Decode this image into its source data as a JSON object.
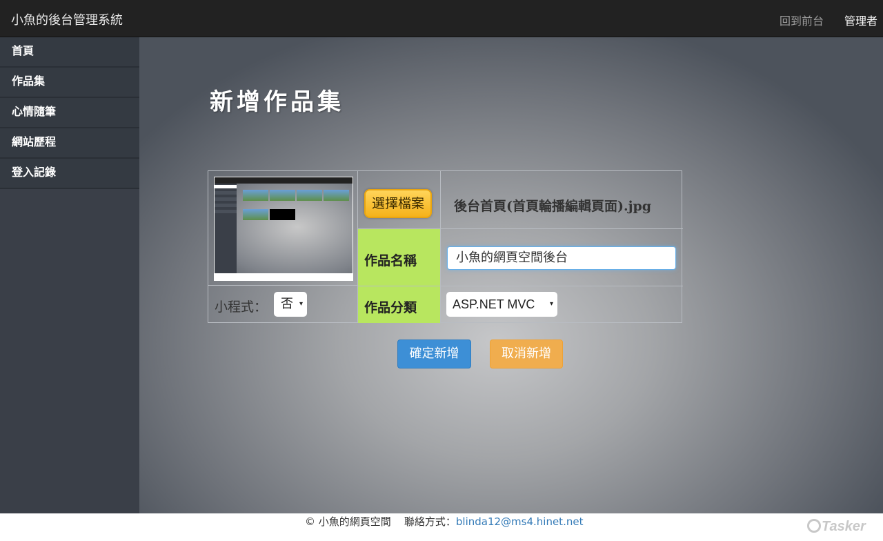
{
  "header": {
    "brand": "小魚的後台管理系統",
    "nav_front": "回到前台",
    "nav_admin": "管理者"
  },
  "sidebar": {
    "items": [
      {
        "label": "首頁"
      },
      {
        "label": "作品集"
      },
      {
        "label": "心情隨筆"
      },
      {
        "label": "網站歷程"
      },
      {
        "label": "登入記錄"
      }
    ]
  },
  "main": {
    "title": "新增作品集",
    "form": {
      "file_button": "選擇檔案",
      "file_name": "後台首頁(首頁輪播編輯頁面).jpg",
      "name_label": "作品名稱",
      "name_value": "小魚的網頁空間後台",
      "category_label": "作品分類",
      "category_value": "ASP.NET MVC",
      "program_label": "小程式：",
      "program_value": "否"
    },
    "confirm_button": "確定新增",
    "cancel_button": "取消新增"
  },
  "footer": {
    "copyright": "© 小魚的網頁空間",
    "contact_label": "聯絡方式：",
    "email": "blinda12@ms4.hinet.net",
    "watermark": "Tasker"
  },
  "colors": {
    "topbar": "#222222",
    "sidebar": "#343a42",
    "label_green": "#b8e65f",
    "confirm_blue": "#3d8fd6",
    "cancel_orange": "#f0ad4e",
    "file_button_yellow": "#f5b21a"
  },
  "icons": {
    "select_caret": "▾"
  }
}
